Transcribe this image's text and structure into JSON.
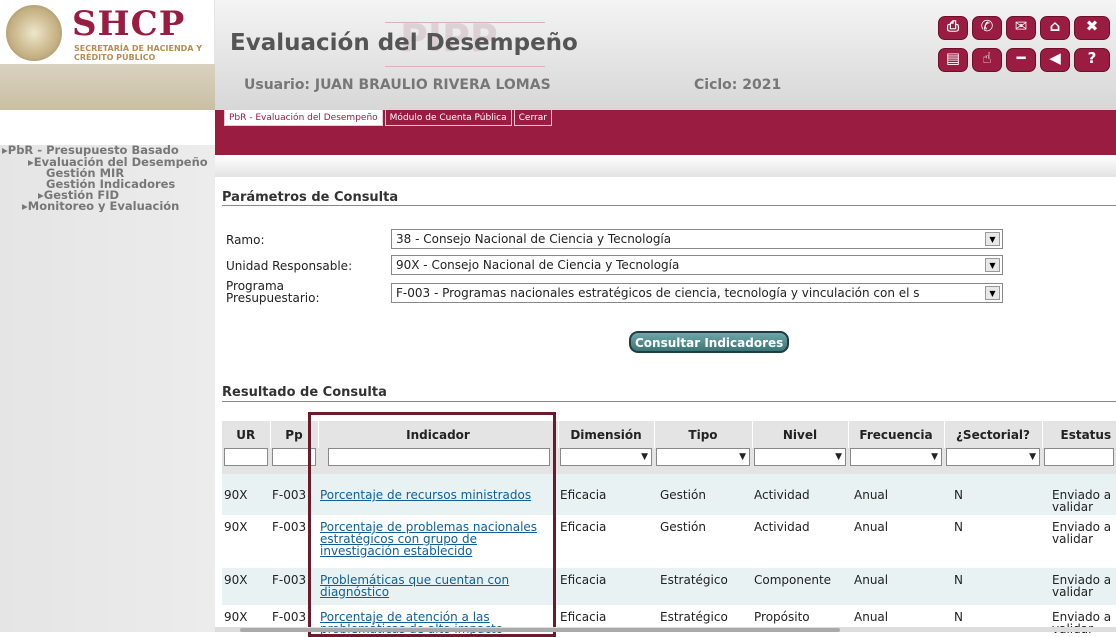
{
  "header": {
    "logo_text": "SHCP",
    "logo_subtitle": "SECRETARÍA DE HACIENDA Y CRÉDITO PÚBLICO",
    "app_title": "Evaluación del Desempeño",
    "watermark": "PIPP",
    "user": "Usuario: JUAN BRAULIO RIVERA LOMAS",
    "cycle": "Ciclo: 2021",
    "toolbar_icons": [
      "print-icon",
      "phone-icon",
      "mail-icon",
      "home-icon",
      "close-icon",
      "document-icon",
      "hand-icon",
      "minus-icon",
      "back-icon",
      "help-icon"
    ]
  },
  "tabs": [
    "PbR - Evaluación del Desempeño",
    "Módulo de Cuenta Pública",
    "Cerrar"
  ],
  "sidebar": {
    "items": [
      {
        "label": "▸PbR - Presupuesto Basado"
      },
      {
        "label": "▸Evaluación del Desempeño"
      },
      {
        "label": "Gestión MIR"
      },
      {
        "label": "Gestión Indicadores"
      },
      {
        "label": "▸Gestión FID"
      },
      {
        "label": "▸Monitoreo y Evaluación"
      }
    ]
  },
  "params": {
    "title": "Parámetros de Consulta",
    "ramo_label": "Ramo:",
    "ramo_value": "38 - Consejo Nacional de Ciencia y Tecnología",
    "ur_label": "Unidad Responsable:",
    "ur_value": "90X - Consejo Nacional de Ciencia y Tecnología",
    "pp_label": "Programa Presupuestario:",
    "pp_value": "F-003 - Programas nacionales estratégicos de ciencia, tecnología y vinculación con el s",
    "button": "Consultar Indicadores"
  },
  "results": {
    "title": "Resultado de Consulta",
    "columns": [
      "UR",
      "Pp",
      "Indicador",
      "Dimensión",
      "Tipo",
      "Nivel",
      "Frecuencia",
      "¿Sectorial?",
      "Estatus"
    ],
    "rows": [
      [
        "90X",
        "F-003",
        "Porcentaje de recursos ministrados",
        "Eficacia",
        "Gestión",
        "Actividad",
        "Anual",
        "N",
        "Enviado a validar"
      ],
      [
        "90X",
        "F-003",
        "Porcentaje de problemas nacionales estratégicos con grupo de investigación establecido",
        "Eficacia",
        "Gestión",
        "Actividad",
        "Anual",
        "N",
        "Enviado a validar"
      ],
      [
        "90X",
        "F-003",
        "Problemáticas que cuentan con diagnóstico",
        "Eficacia",
        "Estratégico",
        "Componente",
        "Anual",
        "N",
        "Enviado a validar"
      ],
      [
        "90X",
        "F-003",
        "Porcentaje de atención a las problemáticas de alto impacto",
        "Eficacia",
        "Estratégico",
        "Propósito",
        "Anual",
        "N",
        "Enviado a validar"
      ]
    ]
  },
  "colors": {
    "brand": "#9b1c41",
    "button": "#3c7577",
    "link": "#0e5f99"
  }
}
